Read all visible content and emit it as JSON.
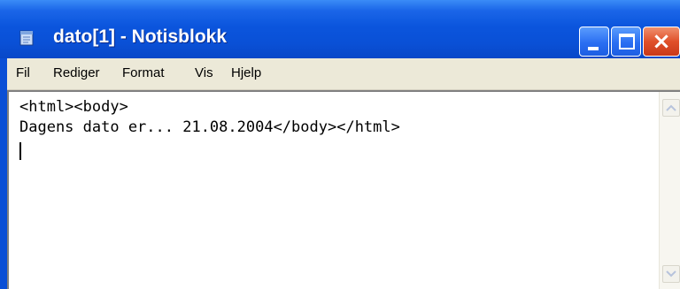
{
  "window": {
    "title": "dato[1] - Notisblokk",
    "icon": "notepad-icon",
    "controls": {
      "minimize": "minimize-icon",
      "maximize": "maximize-icon",
      "close": "×"
    },
    "colors": {
      "titlebar": "#0a50d6",
      "close": "#e0502a",
      "menubar": "#ece9d8"
    }
  },
  "menu": {
    "items": [
      "Fil",
      "Rediger",
      "Format",
      "Vis",
      "Hjelp"
    ]
  },
  "editor": {
    "lines": [
      "<html><body>",
      "Dagens dato er... 21.08.2004</body></html>"
    ]
  },
  "scrollbar": {
    "up": "scroll-up-arrow-icon",
    "down": "scroll-down-arrow-icon"
  }
}
